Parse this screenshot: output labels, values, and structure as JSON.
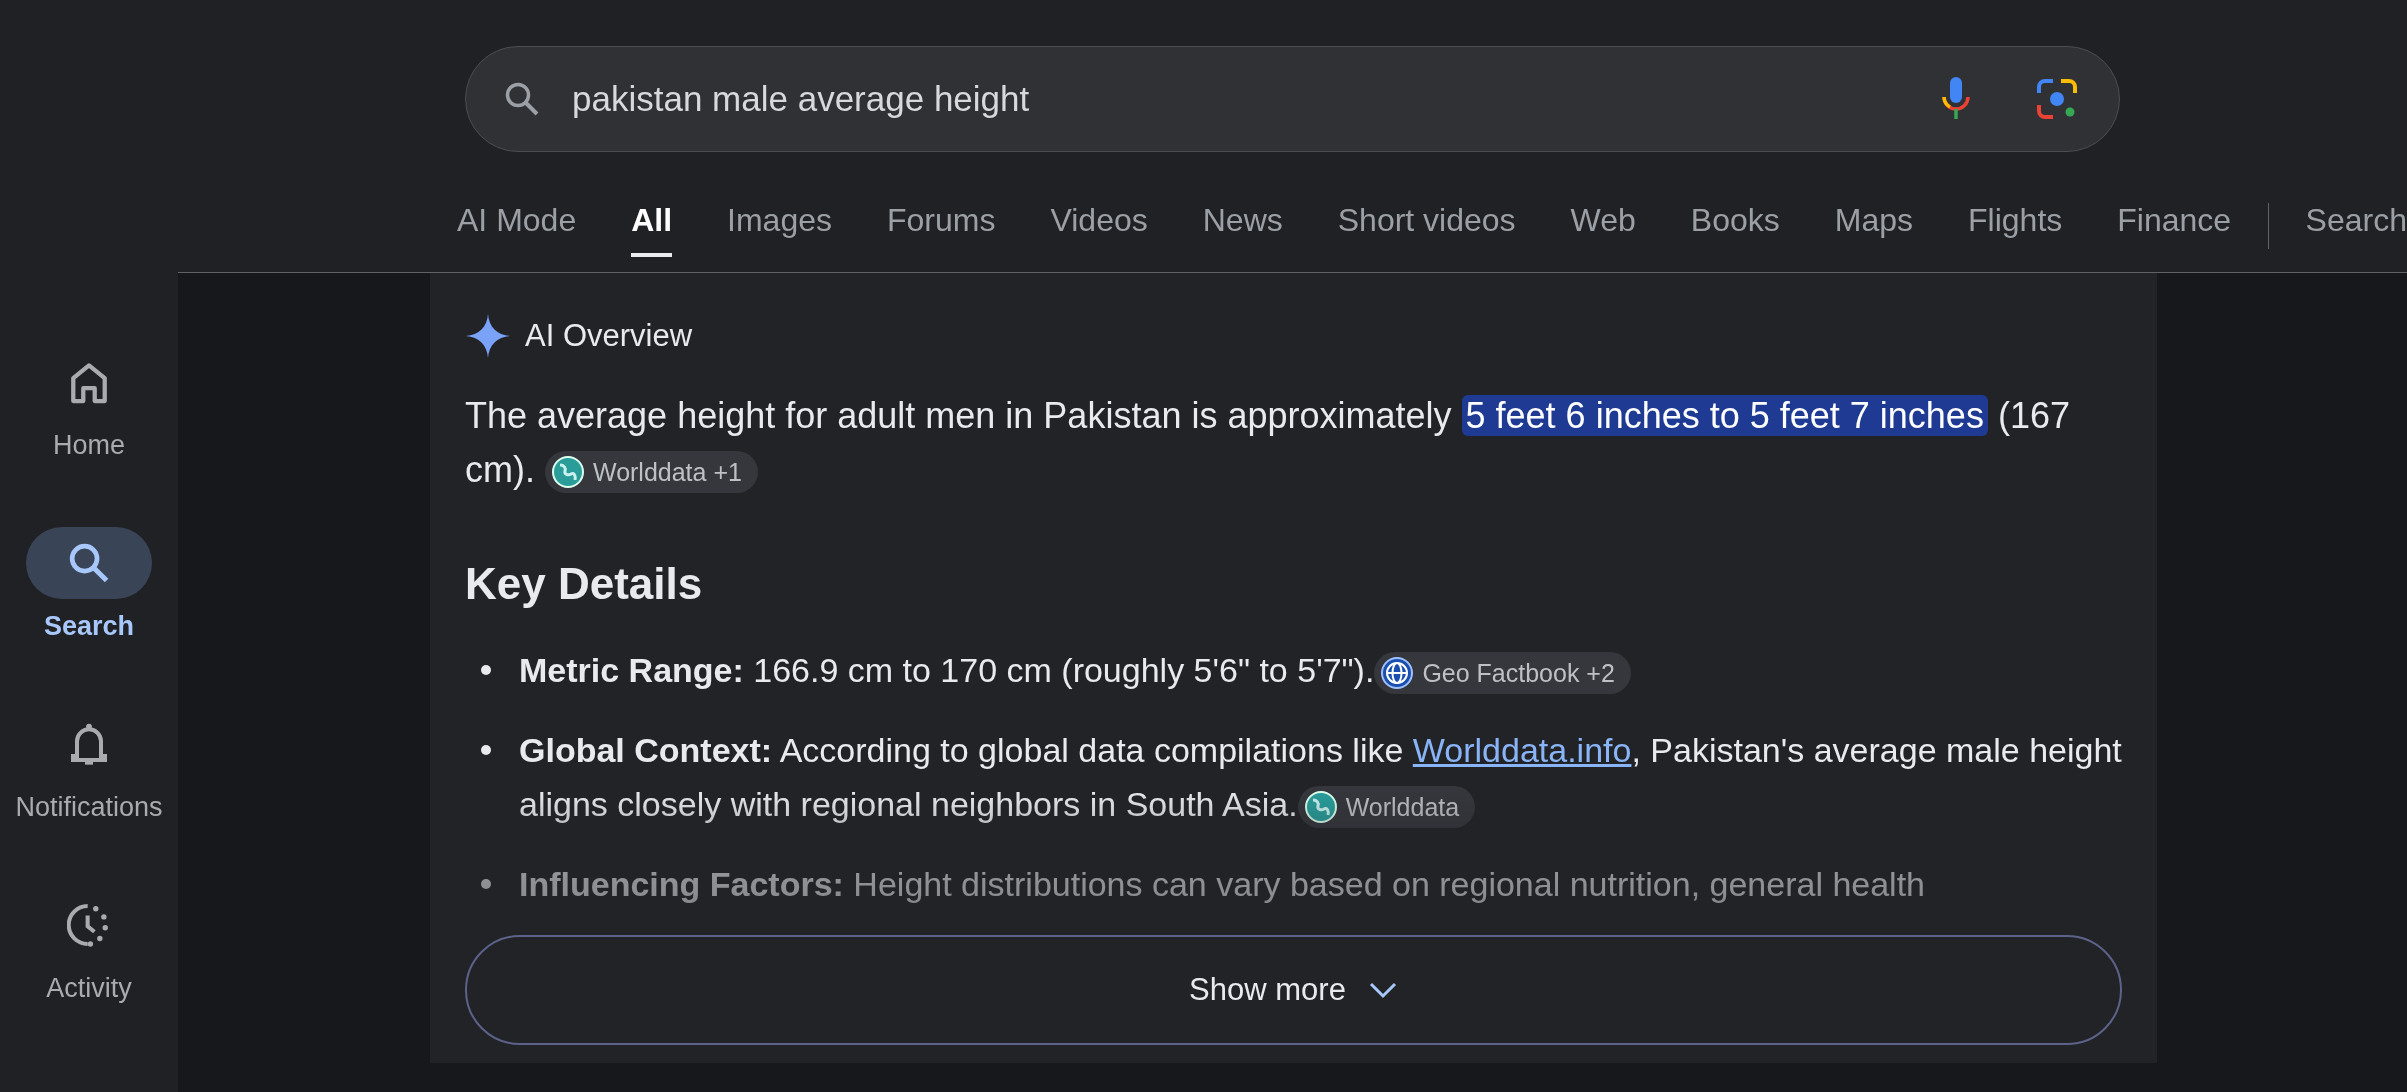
{
  "search": {
    "query": "pakistan male average height"
  },
  "tabs": [
    {
      "label": "AI Mode",
      "selected": false
    },
    {
      "label": "All",
      "selected": true
    },
    {
      "label": "Images",
      "selected": false
    },
    {
      "label": "Forums",
      "selected": false
    },
    {
      "label": "Videos",
      "selected": false
    },
    {
      "label": "News",
      "selected": false
    },
    {
      "label": "Short videos",
      "selected": false
    },
    {
      "label": "Web",
      "selected": false
    },
    {
      "label": "Books",
      "selected": false
    },
    {
      "label": "Maps",
      "selected": false
    },
    {
      "label": "Flights",
      "selected": false
    },
    {
      "label": "Finance",
      "selected": false
    },
    {
      "label": "Search",
      "selected": false
    }
  ],
  "sidebar": {
    "items": [
      {
        "label": "Home",
        "kind": "home",
        "selected": false
      },
      {
        "label": "Search",
        "kind": "search",
        "selected": true
      },
      {
        "label": "Notifications",
        "kind": "bell",
        "selected": false
      },
      {
        "label": "Activity",
        "kind": "activity",
        "selected": false
      }
    ]
  },
  "ai_overview": {
    "title": "AI Overview",
    "summary": {
      "before": "The average height for adult men in Pakistan is approximately ",
      "highlight": "5 feet 6 inches to 5 feet 7 inches",
      "after": " (167 cm).",
      "source": {
        "label": "Worlddata +1",
        "kind": "earth"
      }
    },
    "heading": "Key Details",
    "bullets": [
      {
        "label": "Metric Range:",
        "text": "166.9 cm to 170 cm (roughly 5'6\" to 5'7\").",
        "source": {
          "label": "Geo Factbook +2",
          "kind": "globe"
        }
      },
      {
        "label": "Global Context:",
        "text": "According to global data compilations like ",
        "link": "Worlddata.info",
        "after": ", Pakistan's average male height aligns closely with regional neighbors in South Asia.",
        "source": {
          "label": "Worlddata",
          "kind": "earth"
        }
      },
      {
        "label": "Influencing Factors:",
        "text": "Height distributions can vary based on regional nutrition, general health"
      }
    ],
    "show_more": "Show more"
  }
}
